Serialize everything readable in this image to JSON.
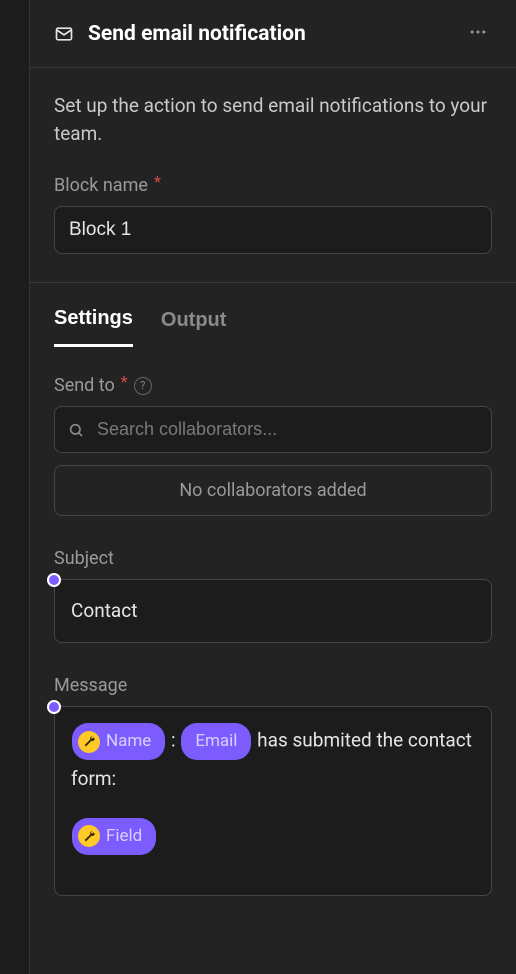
{
  "header": {
    "title": "Send email notification"
  },
  "description": "Set up the action to send email notifications to your team.",
  "block_name": {
    "label": "Block name",
    "value": "Block 1"
  },
  "tabs": {
    "settings": "Settings",
    "output": "Output"
  },
  "send_to": {
    "label": "Send to",
    "placeholder": "Search collaborators...",
    "empty": "No collaborators added"
  },
  "subject": {
    "label": "Subject",
    "value": "Contact"
  },
  "message": {
    "label": "Message",
    "pill_name": "Name",
    "sep": ":",
    "pill_email": "Email",
    "text1": " has submited the contact form:",
    "pill_field": "Field"
  }
}
